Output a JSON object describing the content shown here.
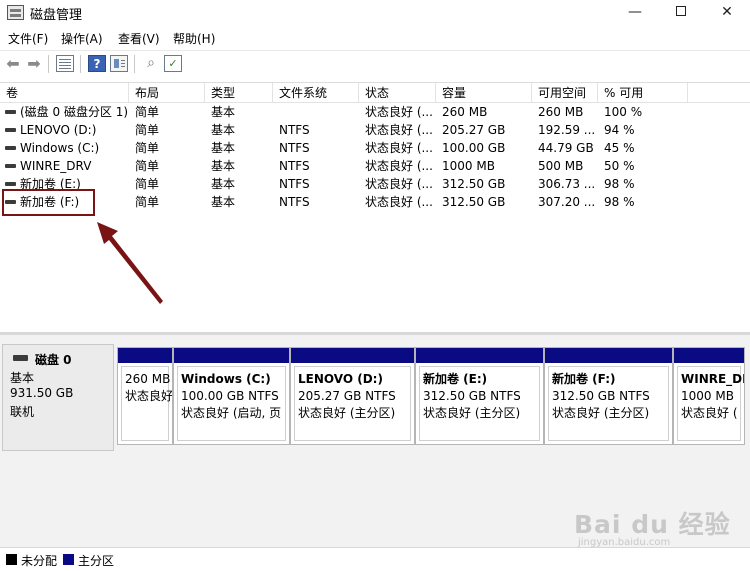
{
  "window": {
    "title": "磁盘管理",
    "minimize_glyph": "—",
    "close_glyph": "✕"
  },
  "menu": [
    "文件(F)",
    "操作(A)",
    "查看(V)",
    "帮助(H)"
  ],
  "toolbar": {
    "back_glyph": "⬅",
    "forward_glyph": "➡",
    "help_glyph": "?",
    "key_glyph": "⌕",
    "check_glyph": "✓"
  },
  "volume_list": {
    "columns": [
      "卷",
      "布局",
      "类型",
      "文件系统",
      "状态",
      "容量",
      "可用空间",
      "% 可用"
    ],
    "rows": [
      {
        "name": "(磁盘 0 磁盘分区 1)",
        "layout": "简单",
        "type": "基本",
        "fs": "",
        "status": "状态良好 (...",
        "capacity": "260 MB",
        "free": "260 MB",
        "pct": "100 %"
      },
      {
        "name": "LENOVO (D:)",
        "layout": "简单",
        "type": "基本",
        "fs": "NTFS",
        "status": "状态良好 (...",
        "capacity": "205.27 GB",
        "free": "192.59 ...",
        "pct": "94 %"
      },
      {
        "name": "Windows (C:)",
        "layout": "简单",
        "type": "基本",
        "fs": "NTFS",
        "status": "状态良好 (...",
        "capacity": "100.00 GB",
        "free": "44.79 GB",
        "pct": "45 %"
      },
      {
        "name": "WINRE_DRV",
        "layout": "简单",
        "type": "基本",
        "fs": "NTFS",
        "status": "状态良好 (...",
        "capacity": "1000 MB",
        "free": "500 MB",
        "pct": "50 %"
      },
      {
        "name": "新加卷 (E:)",
        "layout": "简单",
        "type": "基本",
        "fs": "NTFS",
        "status": "状态良好 (...",
        "capacity": "312.50 GB",
        "free": "306.73 ...",
        "pct": "98 %"
      },
      {
        "name": "新加卷 (F:)",
        "layout": "简单",
        "type": "基本",
        "fs": "NTFS",
        "status": "状态良好 (...",
        "capacity": "312.50 GB",
        "free": "307.20 ...",
        "pct": "98 %"
      }
    ]
  },
  "disk": {
    "name": "磁盘 0",
    "type": "基本",
    "size": "931.50 GB",
    "state": "联机",
    "partitions": [
      {
        "title": "",
        "size": "260 MB",
        "status": "状态良好"
      },
      {
        "title": "Windows (C:)",
        "size": "100.00 GB NTFS",
        "status": "状态良好 (启动, 页"
      },
      {
        "title": "LENOVO (D:)",
        "size": "205.27 GB NTFS",
        "status": "状态良好 (主分区)"
      },
      {
        "title": "新加卷 (E:)",
        "size": "312.50 GB NTFS",
        "status": "状态良好 (主分区)"
      },
      {
        "title": "新加卷 (F:)",
        "size": "312.50 GB NTFS",
        "status": "状态良好 (主分区)"
      },
      {
        "title": "WINRE_DRV",
        "size": "1000 MB",
        "status": "状态良好 ("
      }
    ]
  },
  "legend": [
    {
      "label": "未分配",
      "color": "#000000"
    },
    {
      "label": "主分区",
      "color": "#0a0a82"
    }
  ],
  "watermark": {
    "brand": "Bai du 经验",
    "url": "jingyan.baidu.com"
  },
  "colors": {
    "primary_partition": "#0a0a82",
    "annotation": "#7a1414"
  }
}
